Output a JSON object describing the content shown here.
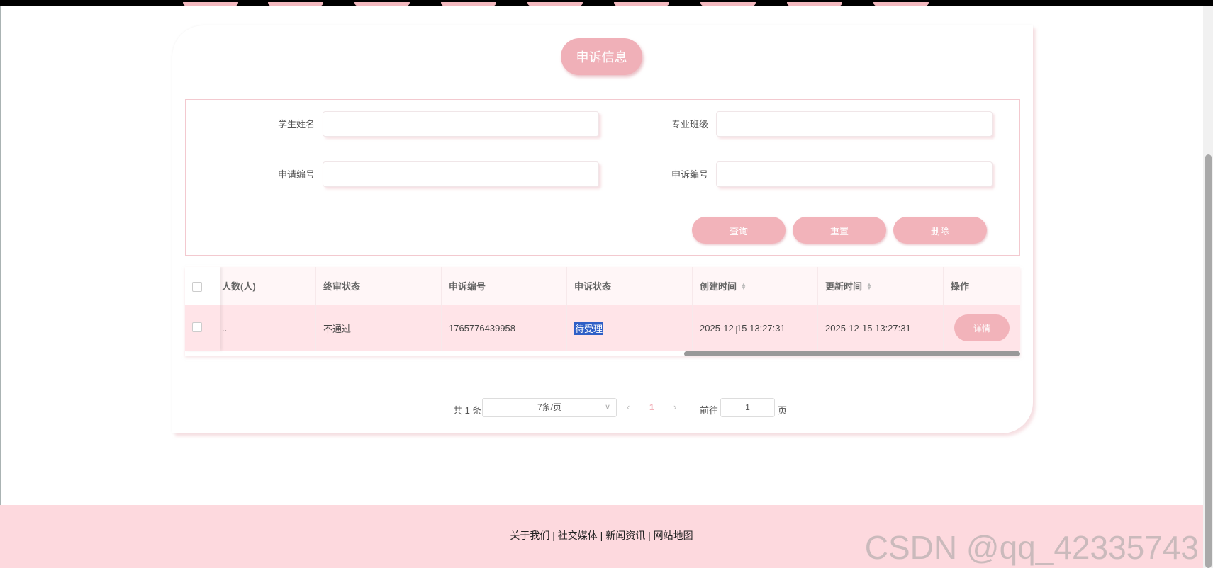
{
  "title": "申诉信息",
  "search": {
    "fields": [
      {
        "label": "学生姓名",
        "value": ""
      },
      {
        "label": "专业班级",
        "value": ""
      },
      {
        "label": "申请编号",
        "value": ""
      },
      {
        "label": "申诉编号",
        "value": ""
      }
    ],
    "buttons": {
      "query": "查询",
      "reset": "重置",
      "delete": "删除"
    }
  },
  "table": {
    "columns": [
      "人数(人)",
      "终审状态",
      "申诉编号",
      "申诉状态",
      "创建时间",
      "更新时间",
      "操作"
    ],
    "rows": [
      {
        "col0": "..",
        "status": "不通过",
        "appeal_no": "1765776439958",
        "appeal_status": "待受理",
        "created": "2025-12-15 13:27:31",
        "updated": "2025-12-15 13:27:31",
        "action": "详情"
      }
    ]
  },
  "pagination": {
    "total": "共 1 条",
    "page_size": "7条/页",
    "current": "1",
    "goto_label": "前往",
    "goto_value": "1",
    "page_suffix": "页"
  },
  "footer": {
    "links": "关于我们 | 社交媒体 | 新闻资讯 | 网站地图"
  },
  "watermark": "CSDN @qq_42335743",
  "colors": {
    "accent": "#f2b3ba",
    "footer": "#fdd9de",
    "row": "#ffe4e8"
  }
}
